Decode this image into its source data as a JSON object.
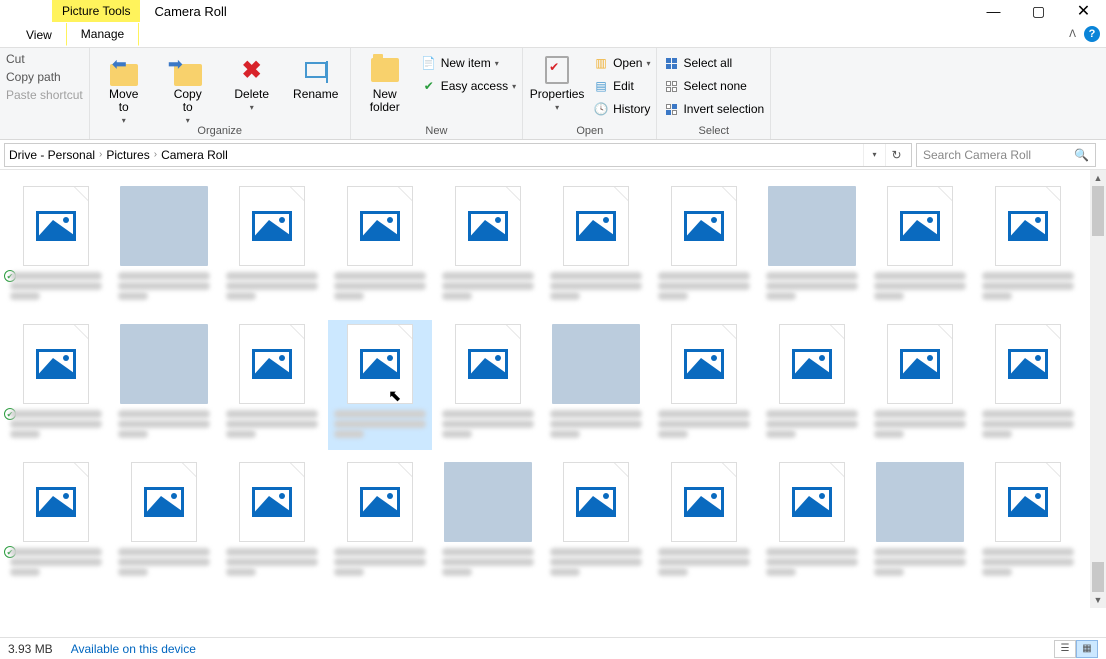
{
  "window": {
    "contextual_tab": "Picture Tools",
    "title": "Camera Roll"
  },
  "tabs": {
    "view": "View",
    "manage": "Manage"
  },
  "ribbon": {
    "clipboard": {
      "cut": "Cut",
      "copy_path": "Copy path",
      "paste_shortcut": "Paste shortcut"
    },
    "organize": {
      "label": "Organize",
      "move_to": "Move\nto",
      "copy_to": "Copy\nto",
      "delete": "Delete",
      "rename": "Rename"
    },
    "new": {
      "label": "New",
      "new_folder": "New\nfolder",
      "new_item": "New item",
      "easy_access": "Easy access"
    },
    "open": {
      "label": "Open",
      "properties": "Properties",
      "open": "Open",
      "edit": "Edit",
      "history": "History"
    },
    "select": {
      "label": "Select",
      "select_all": "Select all",
      "select_none": "Select none",
      "invert": "Invert selection"
    }
  },
  "breadcrumbs": [
    "Drive - Personal",
    "Pictures",
    "Camera Roll"
  ],
  "search": {
    "placeholder": "Search Camera Roll"
  },
  "files": [
    {
      "t": "icon",
      "sync": true
    },
    {
      "t": "photo",
      "cls": "p1"
    },
    {
      "t": "icon"
    },
    {
      "t": "icon"
    },
    {
      "t": "icon"
    },
    {
      "t": "icon"
    },
    {
      "t": "icon"
    },
    {
      "t": "photo",
      "cls": "p2"
    },
    {
      "t": "icon"
    },
    {
      "t": "icon"
    },
    {
      "t": "icon",
      "sync": true
    },
    {
      "t": "photo",
      "cls": "p3"
    },
    {
      "t": "icon"
    },
    {
      "t": "icon",
      "selected": true,
      "cursor": true
    },
    {
      "t": "icon"
    },
    {
      "t": "photo",
      "cls": "p4"
    },
    {
      "t": "icon"
    },
    {
      "t": "icon"
    },
    {
      "t": "icon"
    },
    {
      "t": "icon"
    },
    {
      "t": "icon",
      "sync": true
    },
    {
      "t": "icon"
    },
    {
      "t": "icon"
    },
    {
      "t": "icon"
    },
    {
      "t": "photo",
      "cls": "p5"
    },
    {
      "t": "icon"
    },
    {
      "t": "icon"
    },
    {
      "t": "icon"
    },
    {
      "t": "photo",
      "cls": "p6"
    },
    {
      "t": "icon"
    }
  ],
  "status": {
    "size": "3.93 MB",
    "avail": "Available on this device"
  }
}
